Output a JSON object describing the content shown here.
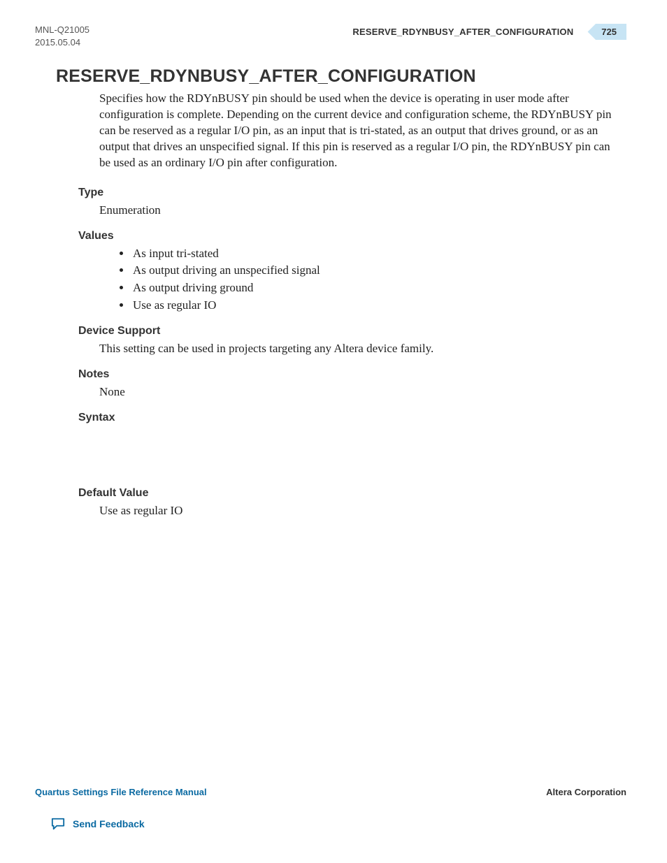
{
  "header": {
    "doc_id": "MNL-Q21005",
    "date": "2015.05.04",
    "running_title": "RESERVE_RDYNBUSY_AFTER_CONFIGURATION",
    "page_number": "725"
  },
  "title": "RESERVE_RDYNBUSY_AFTER_CONFIGURATION",
  "intro": "Specifies how the RDYnBUSY pin should be used when the device is operating in user mode after configuration is complete. Depending on the current device and configuration scheme, the RDYnBUSY pin can be reserved as a regular I/O pin, as an input that is tri-stated, as an output that drives ground, or as an output that drives an unspecified signal. If this pin is reserved as a regular I/O pin, the RDYnBUSY pin can be used as an ordinary I/O pin after configuration.",
  "sections": {
    "type_label": "Type",
    "type_value": "Enumeration",
    "values_label": "Values",
    "values": [
      "As input tri-stated",
      "As output driving an unspecified signal",
      "As output driving ground",
      "Use as regular IO"
    ],
    "device_support_label": "Device Support",
    "device_support_value": "This setting can be used in projects targeting any Altera device family.",
    "notes_label": "Notes",
    "notes_value": "None",
    "syntax_label": "Syntax",
    "default_value_label": "Default Value",
    "default_value": "Use as regular IO"
  },
  "footer": {
    "manual_title": "Quartus Settings File Reference Manual",
    "company": "Altera Corporation",
    "feedback_label": "Send Feedback"
  }
}
